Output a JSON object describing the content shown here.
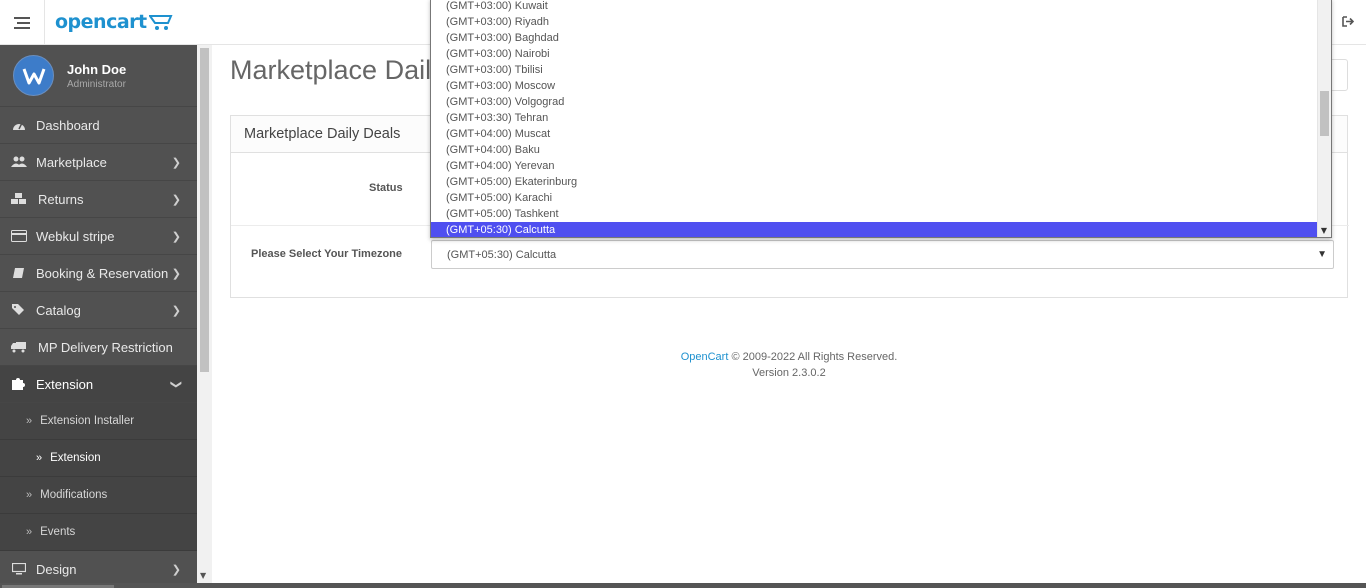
{
  "header": {
    "logo_text": "opencart",
    "logout_fragment": ""
  },
  "user": {
    "name": "John Doe",
    "role": "Administrator"
  },
  "sidebar": {
    "items": [
      {
        "label": "Dashboard",
        "icon": "dashboard-icon",
        "has_children": false
      },
      {
        "label": "Marketplace",
        "icon": "users-icon",
        "has_children": true
      },
      {
        "label": "Returns",
        "icon": "cubes-icon",
        "has_children": true
      },
      {
        "label": "Webkul stripe",
        "icon": "credit-card-icon",
        "has_children": true
      },
      {
        "label": "Booking & Reservation",
        "icon": "book-icon",
        "has_children": true
      },
      {
        "label": "Catalog",
        "icon": "tags-icon",
        "has_children": true
      },
      {
        "label": "MP Delivery Restriction",
        "icon": "truck-icon",
        "has_children": false
      },
      {
        "label": "Extension",
        "icon": "puzzle-icon",
        "has_children": true,
        "expanded": true
      }
    ],
    "extension_children": [
      {
        "label": "Extension Installer"
      },
      {
        "label": "Extension",
        "active": true
      },
      {
        "label": "Modifications"
      },
      {
        "label": "Events"
      }
    ],
    "last_item": {
      "label": "Design",
      "icon": "desktop-icon"
    }
  },
  "main": {
    "page_title": "Marketplace Daily Deals",
    "panel_heading": "Marketplace Daily Deals",
    "status_label": "Status",
    "timezone_label": "Please Select Your Timezone",
    "timezone_value": "(GMT+05:30) Calcutta"
  },
  "dropdown": {
    "options": [
      "(GMT+03:00) Kuwait",
      "(GMT+03:00) Riyadh",
      "(GMT+03:00) Baghdad",
      "(GMT+03:00) Nairobi",
      "(GMT+03:00) Tbilisi",
      "(GMT+03:00) Moscow",
      "(GMT+03:00) Volgograd",
      "(GMT+03:30) Tehran",
      "(GMT+04:00) Muscat",
      "(GMT+04:00) Baku",
      "(GMT+04:00) Yerevan",
      "(GMT+05:00) Ekaterinburg",
      "(GMT+05:00) Karachi",
      "(GMT+05:00) Tashkent",
      "(GMT+05:30) Calcutta"
    ],
    "selected": "(GMT+05:30) Calcutta"
  },
  "footer": {
    "link": "OpenCart",
    "copyright": " © 2009-2022 All Rights Reserved.",
    "version": "Version 2.3.0.2"
  },
  "colors": {
    "sidebar_bg": "#515151",
    "accent": "#1e91cf",
    "selection": "#4f4ff0"
  }
}
